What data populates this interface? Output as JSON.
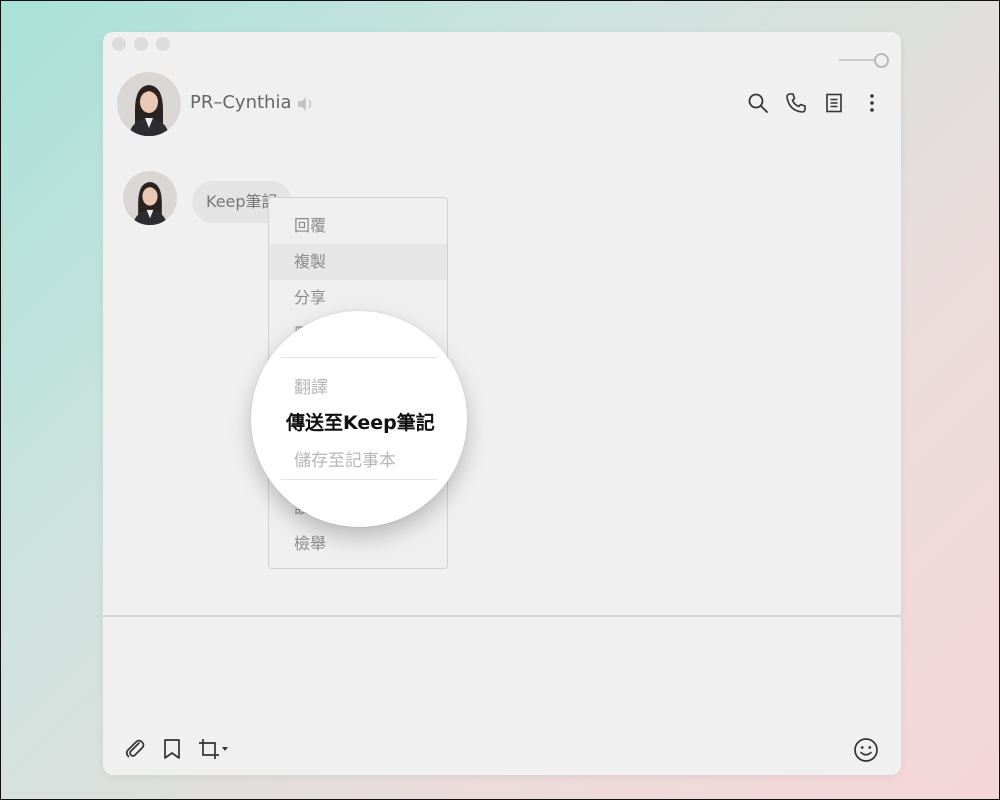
{
  "chat": {
    "name": "PR–Cynthia",
    "message": "Keep筆記"
  },
  "menu": {
    "items": [
      {
        "label": "回覆"
      },
      {
        "label": "複製"
      },
      {
        "label": "分享"
      },
      {
        "label": "刪除"
      },
      {
        "label": "翻譯"
      },
      {
        "label": "傳送至Keep筆記"
      },
      {
        "label": "儲存至記事本"
      },
      {
        "label": "設為公告"
      },
      {
        "label": "檢舉"
      }
    ],
    "highlighted_index": 5
  },
  "icons": {
    "header": [
      "search-icon",
      "phone-icon",
      "notes-icon",
      "more-vertical-icon"
    ],
    "toolbar": [
      "paperclip-icon",
      "bookmark-icon",
      "crop-icon",
      "emoji-icon"
    ]
  },
  "colors": {
    "window_bg": "#f0f0f0",
    "bubble_bg": "#e4e4e4",
    "menu_text": "#8b8b8b",
    "highlight_text": "#111111"
  }
}
